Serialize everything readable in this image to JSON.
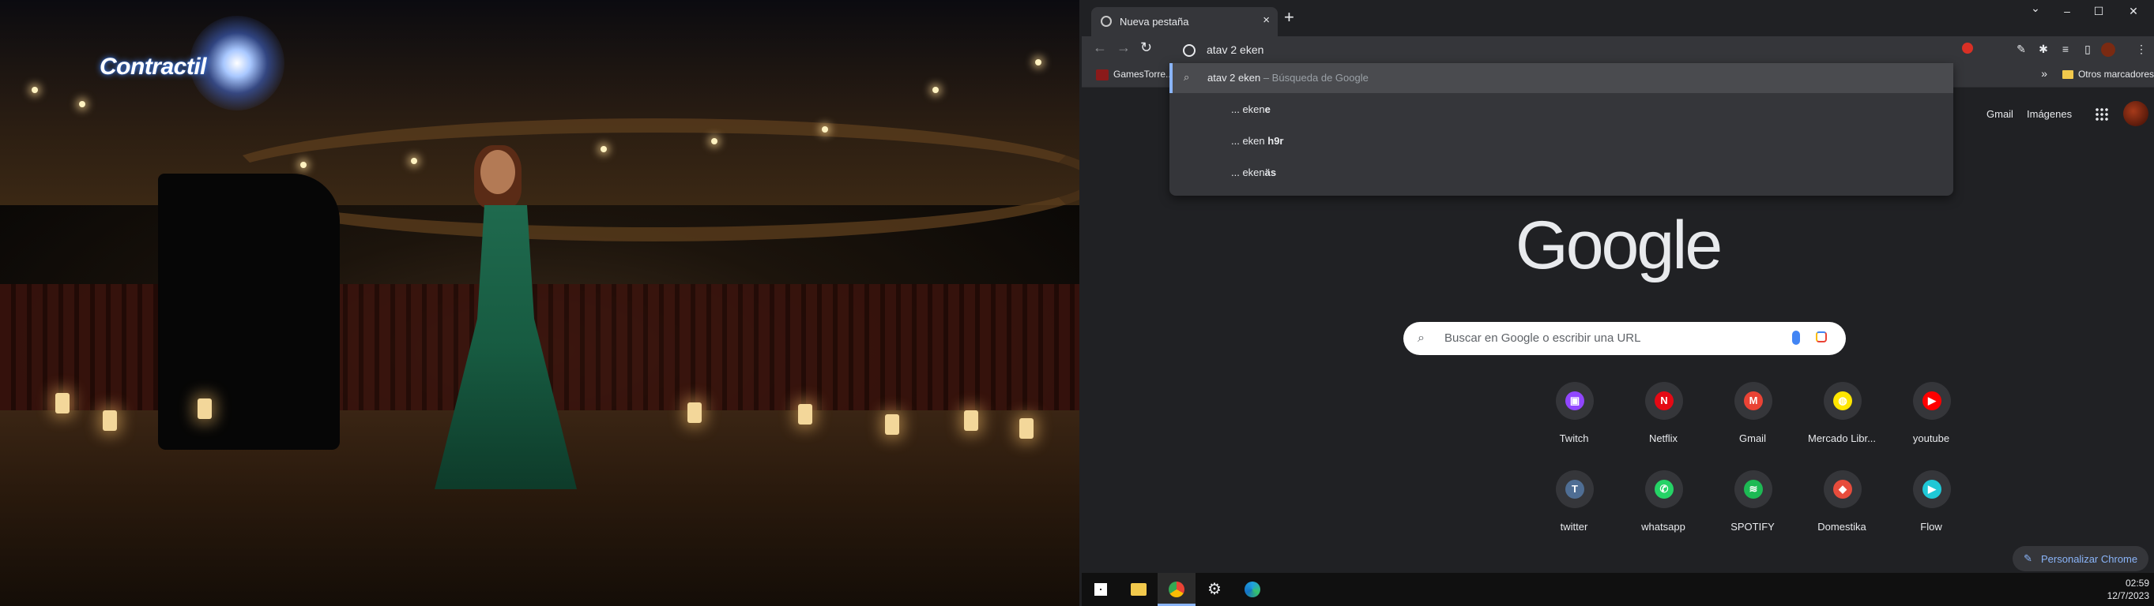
{
  "video": {
    "overlay_logo": "Contractil"
  },
  "browser": {
    "tab": {
      "title": "Nueva pestaña",
      "close": "×"
    },
    "new_tab": "+",
    "window_controls": {
      "chevron": "⌄",
      "minimize": "–",
      "maximize": "☐",
      "close": "✕"
    },
    "omnibox": {
      "value": "atav 2 eken"
    },
    "suggestions": [
      {
        "text": "atav 2 eken",
        "description": " – Búsqueda de Google",
        "selected": true
      },
      {
        "prefix": "... eken",
        "bold": "e"
      },
      {
        "prefix": "... eken ",
        "bold": "h9r"
      },
      {
        "prefix": "... eken",
        "bold": "äs"
      }
    ],
    "bookmarks": {
      "items": [
        {
          "label": "GamesTorre..."
        }
      ],
      "more": "»",
      "others": "Otros marcadores"
    }
  },
  "ntp": {
    "header_links": {
      "gmail": "Gmail",
      "images": "Imágenes"
    },
    "logo": "Google",
    "search_placeholder": "Buscar en Google o escribir una URL",
    "shortcuts": [
      {
        "label": "Twitch",
        "icon": "twitch-icon",
        "glyph": "▣",
        "color": "#9146ff"
      },
      {
        "label": "Netflix",
        "icon": "netflix-icon",
        "glyph": "N",
        "color": "#e50914"
      },
      {
        "label": "Gmail",
        "icon": "gmail-icon",
        "glyph": "M",
        "color": "#ea4335"
      },
      {
        "label": "Mercado Libr...",
        "icon": "mercadolibre-icon",
        "glyph": "◍",
        "color": "#ffe600"
      },
      {
        "label": "youtube",
        "icon": "youtube-icon",
        "glyph": "▶",
        "color": "#ff0000"
      },
      {
        "label": "twitter",
        "icon": "twitter-icon",
        "glyph": "T",
        "color": "#4f6e94"
      },
      {
        "label": "whatsapp",
        "icon": "whatsapp-icon",
        "glyph": "✆",
        "color": "#25d366"
      },
      {
        "label": "SPOTIFY",
        "icon": "spotify-icon",
        "glyph": "≋",
        "color": "#1db954"
      },
      {
        "label": "Domestika",
        "icon": "domestika-icon",
        "glyph": "◆",
        "color": "#e74c3c"
      },
      {
        "label": "Flow",
        "icon": "flow-icon",
        "glyph": "▶",
        "color": "#1fc8d6"
      }
    ],
    "customize": "Personalizar Chrome"
  },
  "taskbar": {
    "time": "02:59",
    "date": "12/7/2023"
  }
}
